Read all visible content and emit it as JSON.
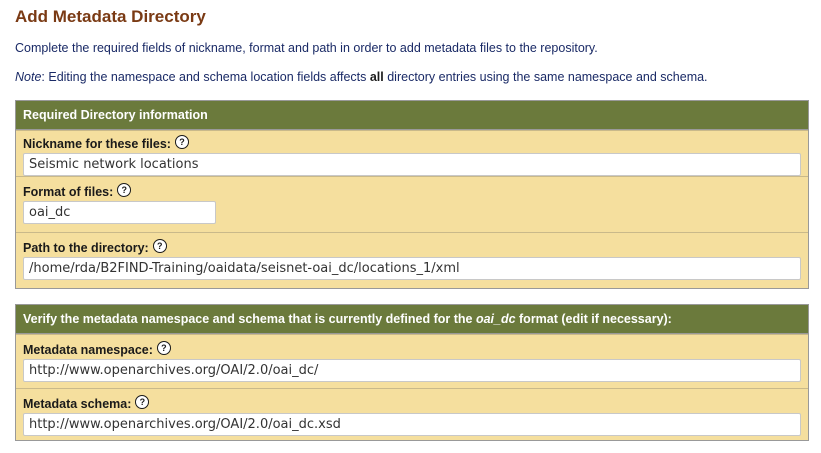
{
  "page": {
    "title": "Add Metadata Directory",
    "intro": "Complete the required fields of nickname, format and path in order to add metadata files to the repository.",
    "note_label": "Note",
    "note_text_before": ": Editing the namespace and schema location fields affects ",
    "note_bold": "all",
    "note_text_after": " directory entries using the same namespace and schema."
  },
  "required_section": {
    "header": "Required Directory information",
    "nickname": {
      "label": "Nickname for these files:",
      "value": "Seismic network locations"
    },
    "format": {
      "label": "Format of files:",
      "value": "oai_dc"
    },
    "path": {
      "label": "Path to the directory:",
      "value": "/home/rda/B2FIND-Training/oaidata/seisnet-oai_dc/locations_1/xml"
    }
  },
  "verify_section": {
    "header_before": "Verify the metadata namespace and schema that is currently defined for the ",
    "header_format": "oai_dc",
    "header_after": " format (edit if necessary):",
    "namespace": {
      "label": "Metadata namespace:",
      "value": "http://www.openarchives.org/OAI/2.0/oai_dc/"
    },
    "schema": {
      "label": "Metadata schema:",
      "value": "http://www.openarchives.org/OAI/2.0/oai_dc.xsd"
    }
  },
  "help_glyph": "?",
  "icons": {
    "help": "question-circle-icon"
  },
  "colors": {
    "title": "#7a3a14",
    "text": "#1a2a66",
    "section_header_bg": "#6b7a3c",
    "section_bg": "#f5df9e"
  }
}
